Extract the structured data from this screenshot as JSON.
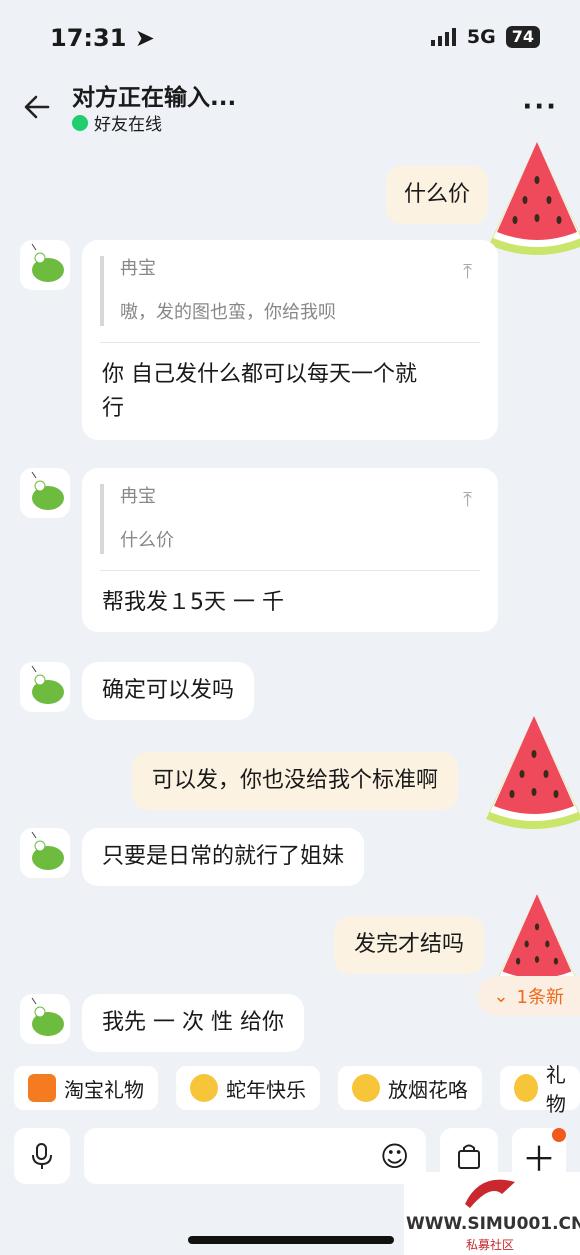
{
  "status": {
    "time": "17:31",
    "network": "5G",
    "battery": "74"
  },
  "header": {
    "title": "对方正在输入...",
    "subtitle": "好友在线"
  },
  "messages": {
    "m1": "什么价",
    "m2": {
      "quote_name": "冉宝",
      "quote_text": "嗷，发的图也蛮，你给我呗",
      "text_l1": "你 自己发什么都可以每天一个就",
      "text_l2": "行"
    },
    "m3": {
      "quote_name": "冉宝",
      "quote_text": "什么价",
      "text": "帮我发１5天 一 千"
    },
    "m4": "确定可以发吗",
    "m5": "可以发，你也没给我个标准啊",
    "m6": "只要是日常的就行了姐妹",
    "m7": "发完才结吗",
    "m8": "我先 一 次 性 给你"
  },
  "new_messages": "1条新",
  "quick_chips": [
    "淘宝礼物",
    "蛇年快乐",
    "放烟花咯",
    "礼物"
  ],
  "watermark": {
    "site": "WWW.SIMU001.CN",
    "label": "私募社区"
  }
}
